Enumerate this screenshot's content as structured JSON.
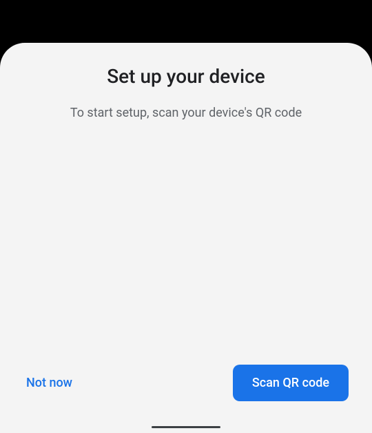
{
  "dialog": {
    "title": "Set up your device",
    "subtitle": "To start setup, scan your device's QR code"
  },
  "actions": {
    "negative": "Not now",
    "positive": "Scan QR code"
  }
}
